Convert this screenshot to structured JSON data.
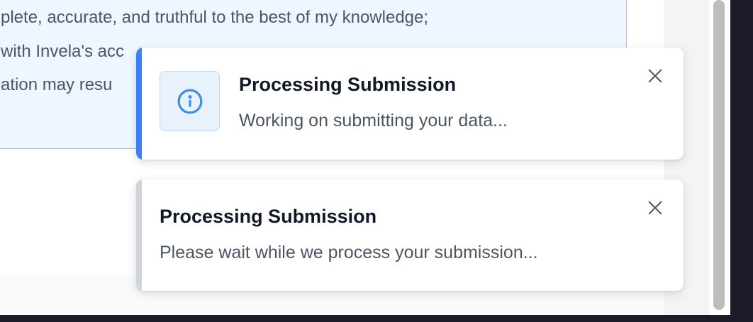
{
  "background": {
    "attestation_lines": [
      "plete, accurate, and truthful to the best of my knowledge;",
      "with Invela's acc",
      "ation may resu"
    ]
  },
  "toasts": [
    {
      "title": "Processing Submission",
      "message": "Working on submitting your data...",
      "icon": "info-icon",
      "accent_color": "#3b82f6",
      "close_icon": "close-icon"
    },
    {
      "title": "Processing Submission",
      "message": "Please wait while we process your submission...",
      "accent_color": "#d1d5db",
      "close_icon": "close-icon"
    }
  ],
  "colors": {
    "info_accent": "#3b82f6",
    "neutral_accent": "#d1d5db",
    "attestation_bg": "#eff6ff",
    "attestation_border": "#93c5fd"
  }
}
